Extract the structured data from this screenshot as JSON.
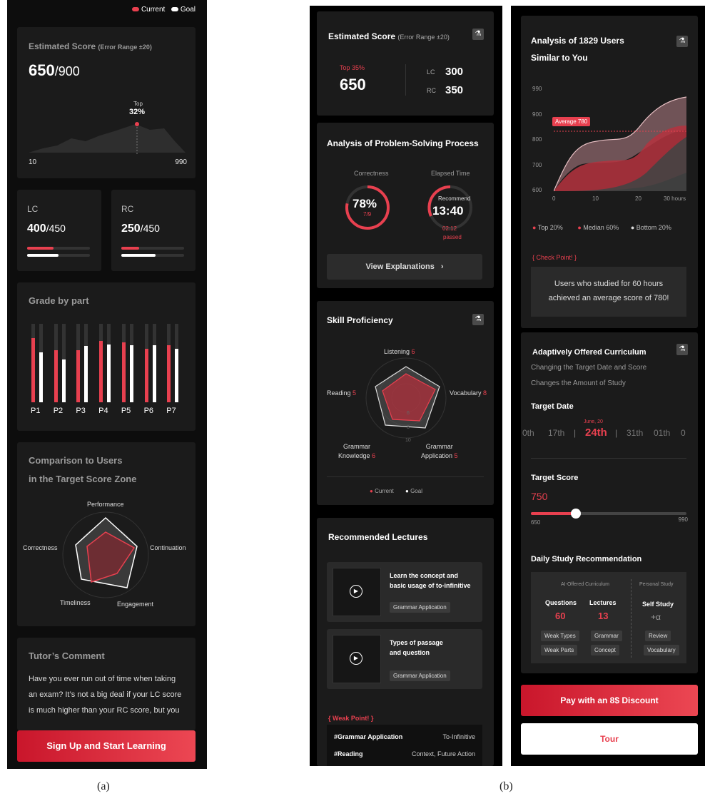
{
  "a": {
    "legend": {
      "current": "Current",
      "goal": "Goal"
    },
    "estimated": {
      "title": "Estimated Score",
      "range": "(Error Range ±20)",
      "score": "650",
      "max": "/900",
      "top_label": "Top",
      "top_value": "32%",
      "axis_min": "10",
      "axis_max": "990"
    },
    "lc": {
      "label": "LC",
      "score": "400",
      "max": "/450",
      "current_pct": 0.42,
      "goal_pct": 0.5
    },
    "rc": {
      "label": "RC",
      "score": "250",
      "max": "/450",
      "current_pct": 0.28,
      "goal_pct": 0.55
    },
    "grade": {
      "title": "Grade by part",
      "parts": [
        {
          "label": "P1",
          "current": 0.82,
          "goal": 0.64
        },
        {
          "label": "P2",
          "current": 0.66,
          "goal": 0.55
        },
        {
          "label": "P3",
          "current": 0.66,
          "goal": 0.72
        },
        {
          "label": "P4",
          "current": 0.78,
          "goal": 0.74
        },
        {
          "label": "P5",
          "current": 0.76,
          "goal": 0.73
        },
        {
          "label": "P6",
          "current": 0.68,
          "goal": 0.73
        },
        {
          "label": "P7",
          "current": 0.73,
          "goal": 0.68
        }
      ]
    },
    "comparison": {
      "title1": "Comparison to Users",
      "title2": "in the Target Score Zone",
      "axes": [
        "Performance",
        "Continuation",
        "Engagement",
        "Timeliness",
        "Correctness"
      ]
    },
    "tutor": {
      "title": "Tutor’s Comment",
      "line1": "Have you ever run out of time when taking",
      "line2": "an exam? It’s not a big deal if your LC score",
      "line3": "is much higher than your RC score, but you"
    },
    "cta": "Sign Up and Start Learning",
    "caption": "(a)"
  },
  "b1": {
    "estimated": {
      "title": "Estimated Score",
      "range": "(Error Range ±20)",
      "top": "Top 35%",
      "score": "650",
      "lc_label": "LC",
      "lc_value": "300",
      "rc_label": "RC",
      "rc_value": "350"
    },
    "process": {
      "title": "Analysis of Problem-Solving Process",
      "correctness_label": "Correctness",
      "correctness_value": "78%",
      "correctness_sub": "7/9",
      "elapsed_label": "Elapsed Time",
      "recommend": "Recommend",
      "time": "13:40",
      "passed_time": "02:12",
      "passed": "passed",
      "correct_fraction": 0.78,
      "button": "View Explanations"
    },
    "skill": {
      "title": "Skill Proficiency",
      "listening": "Listening",
      "listening_v": "6",
      "vocab": "Vocabulary",
      "vocab_v": "8",
      "gapp1": "Grammar",
      "gapp2": "Application",
      "gapp_v": "5",
      "gknow1": "Grammar",
      "gknow2": "Knowledge",
      "gknow_v": "6",
      "reading": "Reading",
      "reading_v": "5",
      "ring1": "6",
      "ring2": "8",
      "ring3": "10",
      "legend_current": "Current",
      "legend_goal": "Goal"
    },
    "lectures": {
      "title": "Recommended Lectures",
      "items": [
        {
          "title1": "Learn the concept and",
          "title2": "basic usage of to-infinitive",
          "tag": "Grammar Application"
        },
        {
          "title1": "Types of passage",
          "title2": "and question",
          "tag": "Grammar Application"
        }
      ],
      "weak_title": "{ Weak Point! }",
      "weak": [
        {
          "key": "#Grammar Application",
          "value": "To-Infinitive"
        },
        {
          "key": "#Reading",
          "value": "Context, Future Action"
        }
      ]
    }
  },
  "b2": {
    "analysis": {
      "title1": "Analysis of 1829 Users",
      "title2": "Similar to You",
      "y_ticks": [
        "990",
        "900",
        "800",
        "700",
        "600"
      ],
      "x_ticks": [
        "0",
        "10",
        "20",
        "30 hours"
      ],
      "average": "Average 780",
      "legend": [
        "Top 20%",
        "Median 60%",
        "Bottom 20%"
      ],
      "checkpoint": "{ Check Point! }",
      "note1": "Users who studied for 60 hours",
      "note2": "achieved an average score of 780!"
    },
    "curriculum": {
      "title": "Adaptively Offered Curriculum",
      "sub1": "Changing the Target Date and Score",
      "sub2": "Changes the Amount of Study",
      "date_title": "Target Date",
      "month": "June, 20",
      "dates": [
        "0th",
        "17th",
        "24th",
        "31th",
        "01th",
        "0"
      ],
      "score_title": "Target Score",
      "score_value": "750",
      "score_min": "650",
      "score_max": "990",
      "score_level": 0.29,
      "daily_title": "Daily Study Recommendation",
      "ai_title": "AI-Offered Curriculum",
      "personal_title": "Personal Study",
      "questions": "Questions",
      "questions_v": "60",
      "lectures": "Lectures",
      "lectures_v": "13",
      "self": "Self Study",
      "self_v": "+α",
      "tags": [
        "Weak Types",
        "Weak Parts",
        "Grammar",
        "Concept",
        "Review",
        "Vocabulary"
      ]
    },
    "pay": "Pay with an 8$ Discount",
    "tour": "Tour",
    "caption": "(b)"
  }
}
